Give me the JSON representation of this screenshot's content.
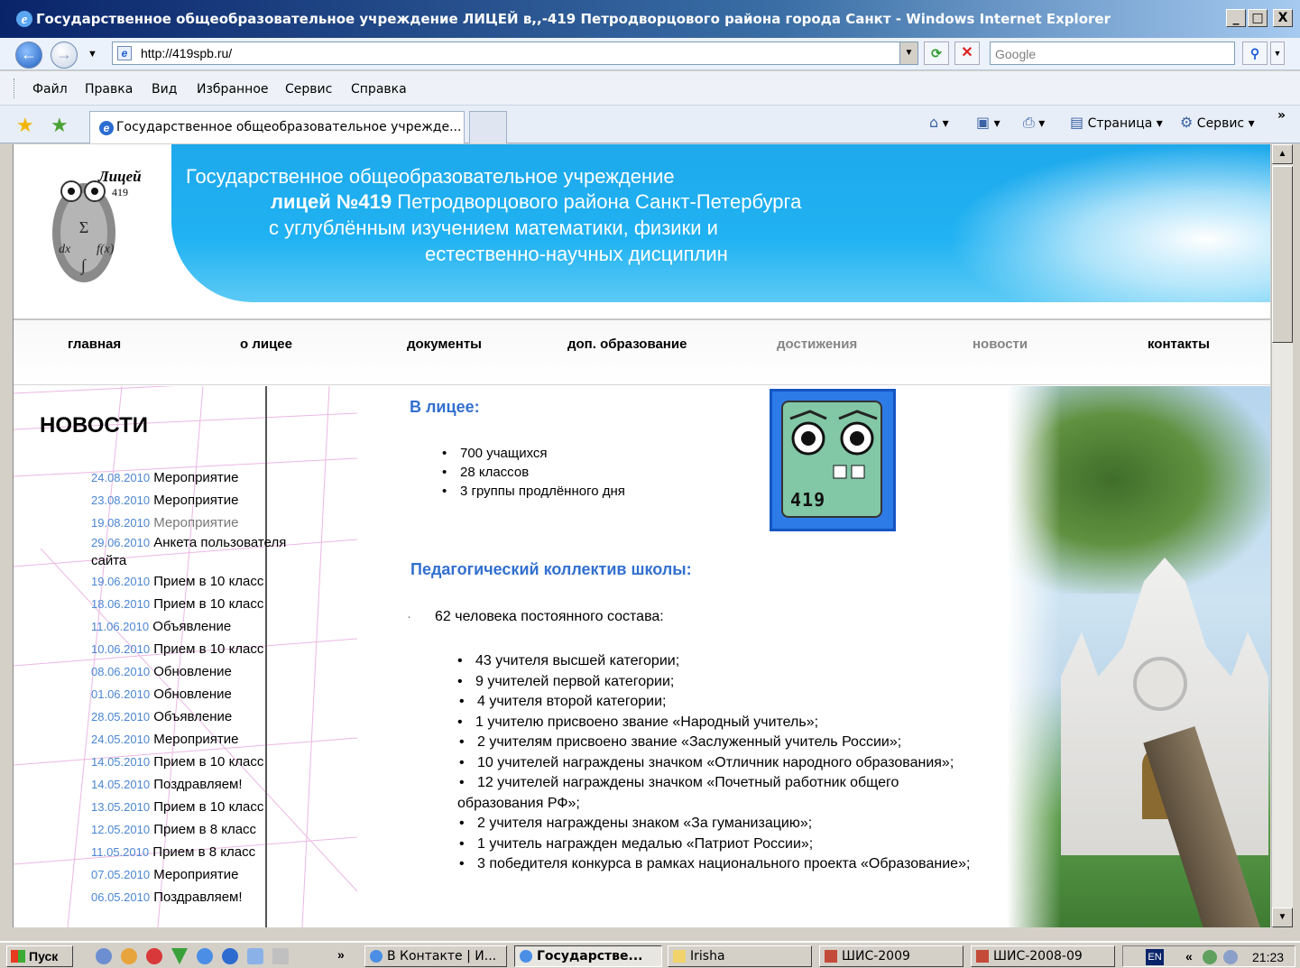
{
  "window": {
    "title": "Государственное общеобразовательное учреждение ЛИЦЕЙ в,,-419 Петродворцового района города Санкт - Windows Internet Explorer",
    "minimize": "_",
    "maximize": "□",
    "close": "X"
  },
  "address": {
    "url": "http://419spb.ru/",
    "search_placeholder": "Google"
  },
  "menu": [
    "Файл",
    "Правка",
    "Вид",
    "Избранное",
    "Сервис",
    "Справка"
  ],
  "tabs": {
    "active_title": "Государственное общеобразовательное учрежде..."
  },
  "toolbar": {
    "page_label": "Страница",
    "tools_label": "Сервис",
    "more": "»"
  },
  "site": {
    "logo_text": "Лицей",
    "logo_number": "419",
    "banner": {
      "line1": "Государственное общеобразовательное учреждение",
      "line2_bold": "лицей №419",
      "line2_rest": " Петродворцового района Санкт-Петербурга",
      "line3": "с углублённым изучением математики, физики и",
      "line4": "естественно-научных дисциплин"
    },
    "nav": [
      {
        "label": "главная",
        "dim": false
      },
      {
        "label": "о лицее",
        "dim": false
      },
      {
        "label": "документы",
        "dim": false
      },
      {
        "label": "доп. образование",
        "dim": false
      },
      {
        "label": "достижения",
        "dim": true
      },
      {
        "label": "новости",
        "dim": true
      },
      {
        "label": "контакты",
        "dim": false
      }
    ],
    "news_title": "НОВОСТИ",
    "news": [
      {
        "date": "24.08.2010",
        "title": "Мероприятие"
      },
      {
        "date": "23.08.2010",
        "title": "Мероприятие"
      },
      {
        "date": "19.08.2010",
        "title": "Мероприятие"
      },
      {
        "date": "29.06.2010",
        "title": "Анкета пользователя сайта"
      },
      {
        "date": "19.06.2010",
        "title": "Прием в 10 класс"
      },
      {
        "date": "18.06.2010",
        "title": "Прием в 10 класс"
      },
      {
        "date": "11.06.2010",
        "title": "Объявление"
      },
      {
        "date": "10.06.2010",
        "title": "Прием в 10 класс"
      },
      {
        "date": "08.06.2010",
        "title": "Обновление"
      },
      {
        "date": "01.06.2010",
        "title": "Обновление"
      },
      {
        "date": "28.05.2010",
        "title": "Объявление"
      },
      {
        "date": "24.05.2010",
        "title": "Мероприятие"
      },
      {
        "date": "14.05.2010",
        "title": "Прием в 10 класс"
      },
      {
        "date": "14.05.2010",
        "title": "Поздравляем!"
      },
      {
        "date": "13.05.2010",
        "title": "Прием в 10 класс"
      },
      {
        "date": "12.05.2010",
        "title": "Прием в 8 класс"
      },
      {
        "date": "11.05.2010",
        "title": "Прием в 8 класс"
      },
      {
        "date": "07.05.2010",
        "title": "Мероприятие"
      },
      {
        "date": "06.05.2010",
        "title": "Поздравляем!"
      }
    ],
    "in_lyceum_title": "В лицее:",
    "in_lyceum": [
      "700 учащихся",
      "28 классов",
      "3 группы продлённого дня"
    ],
    "owl_number": "419",
    "staff_title": "Педагогический коллектив школы:",
    "staff_intro": "62 человека постоянного состава:",
    "staff": [
      "43 учителя высшей категории;",
      "9 учителей первой категории;",
      "4 учителя второй категории;",
      "1 учителю присвоено звание «Народный учитель»;",
      "2 учителям присвоено звание «Заслуженный учитель России»;",
      "10 учителей награждены значком «Отличник народного образования»;",
      "12 учителей награждены значком «Почетный работник общего образования РФ»;",
      "2 учителя награждены знаком «За гуманизацию»;",
      "1 учитель награжден медалью «Патриот России»;",
      "3 победителя конкурса в рамках национального проекта «Образование»;"
    ]
  },
  "taskbar": {
    "start": "Пуск",
    "items": [
      {
        "label": "В Контакте | И...",
        "active": false
      },
      {
        "label": "Государстве...",
        "active": true
      },
      {
        "label": "Irisha",
        "active": false
      },
      {
        "label": "ШИС-2009",
        "active": false
      },
      {
        "label": "ШИС-2008-09",
        "active": false
      }
    ],
    "chevron": "»",
    "lang": "EN",
    "tray_chevron": "«",
    "clock": "21:23"
  }
}
